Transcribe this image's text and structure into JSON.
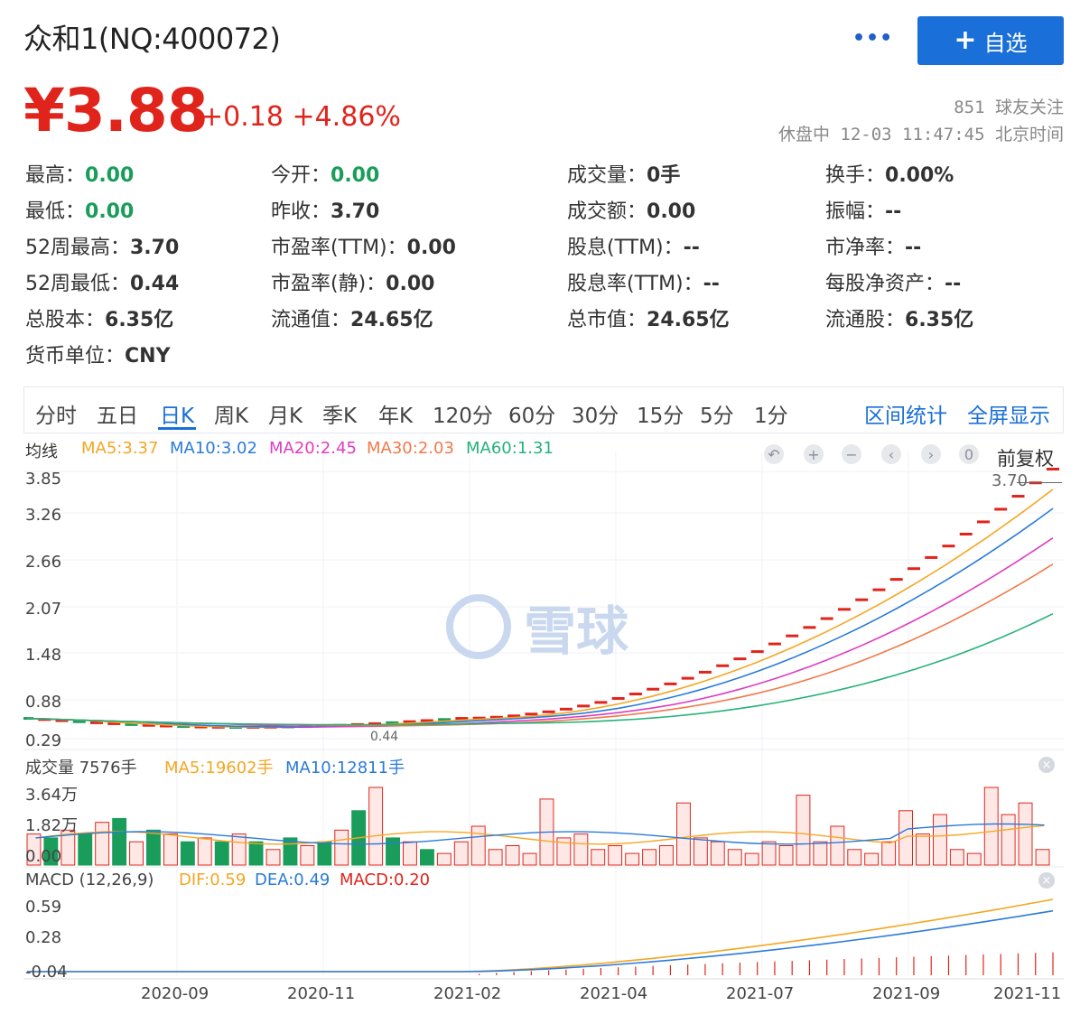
{
  "header": {
    "title": "众和1(NQ:400072)",
    "more_label": "•••",
    "add_label": "自选",
    "add_icon": "+"
  },
  "quote": {
    "price": "¥3.88",
    "change": "+0.18 +4.86%",
    "followers": "851 球友关注",
    "status": "休盘中 12-03 11:47:45 北京时间"
  },
  "stats": [
    {
      "label": "最高：",
      "value": "0.00",
      "green": true
    },
    {
      "label": "今开：",
      "value": "0.00",
      "green": true
    },
    {
      "label": "成交量：",
      "value": "0手",
      "green": false
    },
    {
      "label": "换手：",
      "value": "0.00%",
      "green": false
    },
    {
      "label": "最低：",
      "value": "0.00",
      "green": true
    },
    {
      "label": "昨收：",
      "value": "3.70",
      "green": false
    },
    {
      "label": "成交额：",
      "value": "0.00",
      "green": false
    },
    {
      "label": "振幅：",
      "value": "--",
      "green": false
    },
    {
      "label": "52周最高：",
      "value": "3.70",
      "green": false
    },
    {
      "label": "市盈率(TTM)：",
      "value": "0.00",
      "green": false
    },
    {
      "label": "股息(TTM)：",
      "value": "--",
      "green": false
    },
    {
      "label": "市净率：",
      "value": "--",
      "green": false
    },
    {
      "label": "52周最低：",
      "value": "0.44",
      "green": false
    },
    {
      "label": "市盈率(静)：",
      "value": "0.00",
      "green": false
    },
    {
      "label": "股息率(TTM)：",
      "value": "--",
      "green": false
    },
    {
      "label": "每股净资产：",
      "value": "--",
      "green": false
    },
    {
      "label": "总股本：",
      "value": "6.35亿",
      "green": false
    },
    {
      "label": "流通值：",
      "value": "24.65亿",
      "green": false
    },
    {
      "label": "总市值：",
      "value": "24.65亿",
      "green": false
    },
    {
      "label": "流通股：",
      "value": "6.35亿",
      "green": false
    },
    {
      "label": "货币单位：",
      "value": "CNY",
      "green": false
    }
  ],
  "tabs": [
    "分时",
    "五日",
    "日K",
    "周K",
    "月K",
    "季K",
    "年K",
    "120分",
    "60分",
    "30分",
    "15分",
    "5分",
    "1分"
  ],
  "active_tab": "日K",
  "tab_links": [
    "区间统计",
    "全屏显示"
  ],
  "kline": {
    "ma_title": "均线",
    "ma": [
      {
        "text": "MA5:3.37",
        "color": "#f5a623"
      },
      {
        "text": "MA10:3.02",
        "color": "#2a7bd8"
      },
      {
        "text": "MA20:2.45",
        "color": "#e03cbf"
      },
      {
        "text": "MA30:2.03",
        "color": "#f07a4a"
      },
      {
        "text": "MA60:1.31",
        "color": "#25b27a"
      }
    ],
    "right_label": "前复权",
    "last_close_label": "3.70",
    "low_label": "0.44",
    "controls": [
      "undo-icon",
      "zoom-in-icon",
      "zoom-out-icon",
      "scroll-left-icon",
      "scroll-right-icon",
      "reset-icon"
    ],
    "y_ticks": [
      "3.85",
      "3.26",
      "2.66",
      "2.07",
      "1.48",
      "0.88",
      "0.29"
    ]
  },
  "volume": {
    "title": "成交量 7576手",
    "ma": [
      {
        "text": "MA5:19602手",
        "color": "#f5a623"
      },
      {
        "text": "MA10:12811手",
        "color": "#2a7bd8"
      }
    ],
    "y_ticks": [
      "3.64万",
      "1.82万",
      "0.00"
    ]
  },
  "macd": {
    "title": "MACD (12,26,9)",
    "ma": [
      {
        "text": "DIF:0.59",
        "color": "#f5a623"
      },
      {
        "text": "DEA:0.49",
        "color": "#2a7bd8"
      },
      {
        "text": "MACD:0.20",
        "color": "#e0241b"
      }
    ],
    "y_ticks": [
      "0.59",
      "0.28",
      "-0.04"
    ]
  },
  "x_ticks": [
    "2020-09",
    "2020-11",
    "2021-02",
    "2021-04",
    "2021-07",
    "2021-09",
    "2021-11"
  ],
  "watermark": "雪球",
  "colors": {
    "up": "#e0241b",
    "down": "#1a9d5a",
    "accent": "#1a70d8"
  }
}
